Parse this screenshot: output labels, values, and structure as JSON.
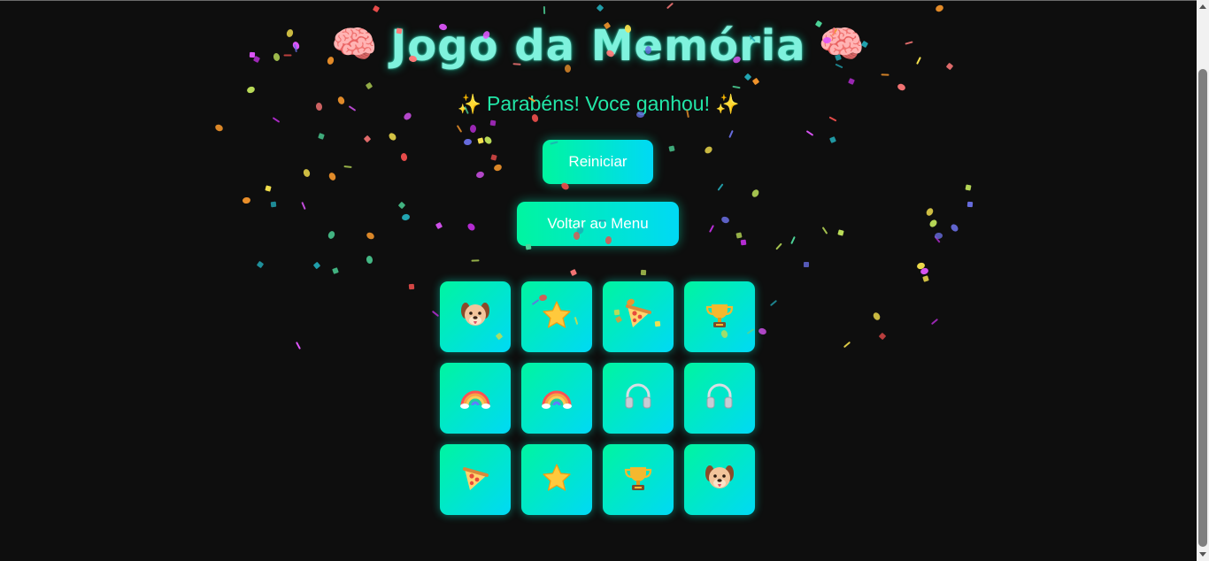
{
  "page": {
    "background": "#0e0e0e"
  },
  "header": {
    "title": "Jogo da Memória",
    "title_icon": "brain-icon",
    "title_color": "#7ff2dd"
  },
  "status": {
    "message": "Parabéns! Voce ganhou!",
    "icon": "sparkles-icon",
    "color": "#22e6a7"
  },
  "buttons": {
    "restart_label": "Reiniciar",
    "menu_label": "Voltar ao Menu",
    "gradient_start": "#00f5a0",
    "gradient_end": "#00d9f5"
  },
  "board": {
    "columns": 4,
    "rows": 3,
    "all_matched": true,
    "cards": [
      {
        "icon": "dog-face-icon",
        "revealed": true
      },
      {
        "icon": "star-icon",
        "revealed": true
      },
      {
        "icon": "pizza-icon",
        "revealed": true
      },
      {
        "icon": "trophy-icon",
        "revealed": true
      },
      {
        "icon": "rainbow-icon",
        "revealed": true
      },
      {
        "icon": "rainbow-icon",
        "revealed": true
      },
      {
        "icon": "headphones-icon",
        "revealed": true
      },
      {
        "icon": "headphones-icon",
        "revealed": true
      },
      {
        "icon": "pizza-icon",
        "revealed": true
      },
      {
        "icon": "star-icon",
        "revealed": true
      },
      {
        "icon": "trophy-icon",
        "revealed": true
      },
      {
        "icon": "dog-face-icon",
        "revealed": true
      }
    ]
  },
  "confetti": {
    "visible": true,
    "colors": [
      "#f4e04d",
      "#e056fd",
      "#4dd599",
      "#f0932b",
      "#eb4d4b",
      "#22a6b3",
      "#be2edd",
      "#badc58",
      "#686de0",
      "#ff7979"
    ]
  }
}
